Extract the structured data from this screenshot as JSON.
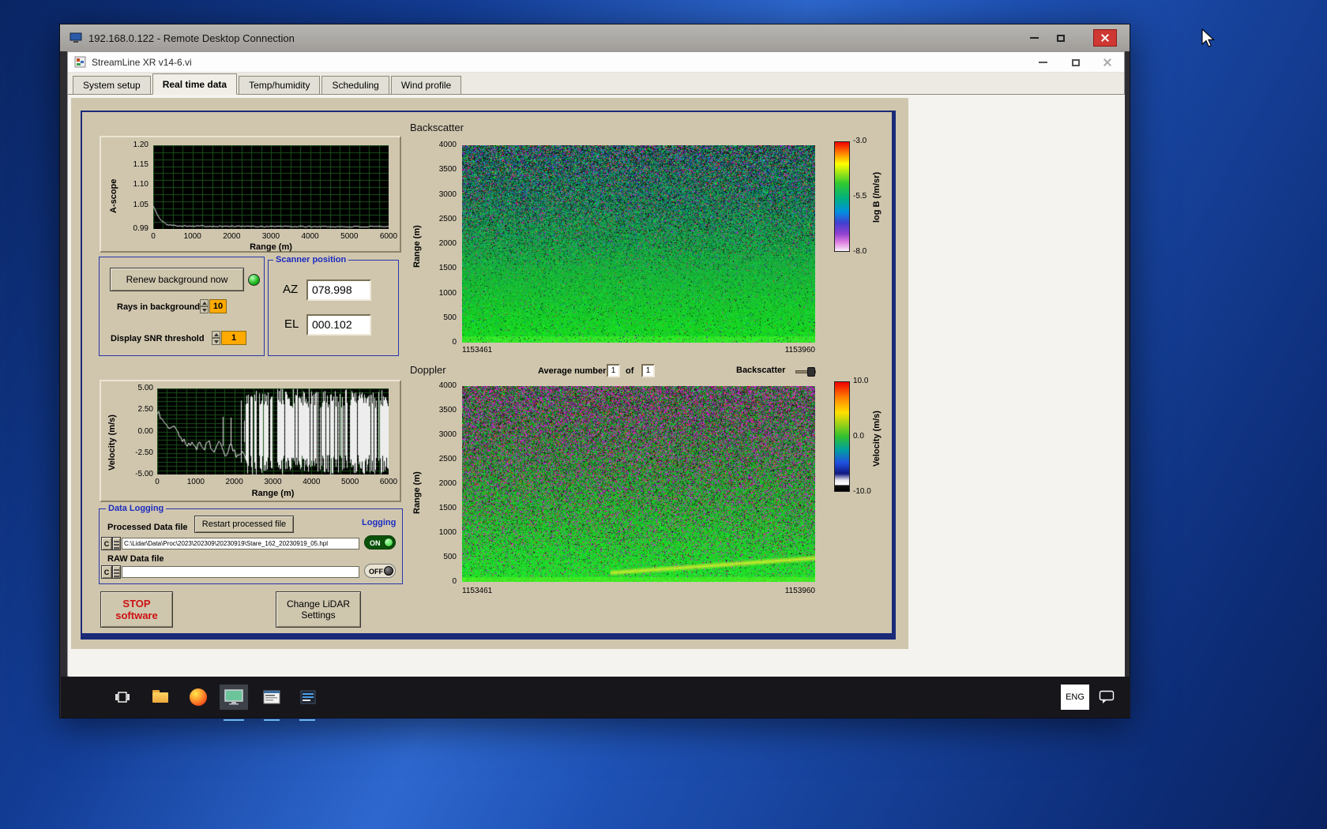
{
  "rdp_window": {
    "title": "192.168.0.122 - Remote Desktop Connection"
  },
  "app_window": {
    "title": "StreamLine XR v14-6.vi",
    "tabs": [
      {
        "label": "System setup"
      },
      {
        "label": "Real time data"
      },
      {
        "label": "Temp/humidity"
      },
      {
        "label": "Scheduling"
      },
      {
        "label": "Wind profile"
      }
    ]
  },
  "panel": {
    "ascope": {
      "ylabel": "A-scope",
      "xlabel": "Range (m)",
      "yticks": [
        "1.20",
        "1.15",
        "1.10",
        "1.05",
        "0.99"
      ],
      "xticks": [
        "0",
        "1000",
        "2000",
        "3000",
        "4000",
        "5000",
        "6000"
      ]
    },
    "background_controls": {
      "renew_button": "Renew background now",
      "rays_label": "Rays in background",
      "rays_value": "10",
      "snr_label": "Display SNR threshold",
      "snr_value": "1"
    },
    "scanner": {
      "title": "Scanner position",
      "az_label": "AZ",
      "az_value": "078.998",
      "el_label": "EL",
      "el_value": "000.102"
    },
    "backscatter": {
      "title": "Backscatter",
      "ylabel": "Range (m)",
      "yticks": [
        "4000",
        "3500",
        "3000",
        "2500",
        "2000",
        "1500",
        "1000",
        "500",
        "0"
      ],
      "x_start": "1153461",
      "x_end": "1153960",
      "colorbar_label": "log B (/m/sr)",
      "colorbar_ticks": [
        "-3.0",
        "-5.5",
        "-8.0"
      ]
    },
    "doppler": {
      "title": "Doppler",
      "average_label": "Average number",
      "average_value": "1",
      "of_label": "of",
      "count_value": "1",
      "toggle_label": "Backscatter",
      "ylabel": "Range (m)",
      "yticks": [
        "4000",
        "3500",
        "3000",
        "2500",
        "2000",
        "1500",
        "1000",
        "500",
        "0"
      ],
      "x_start": "1153461",
      "x_end": "1153960",
      "colorbar_label": "Velocity (m/s)",
      "colorbar_ticks": [
        "10.0",
        "0.0",
        "-10.0"
      ]
    },
    "velocity_scope": {
      "ylabel": "Velocity (m/s)",
      "xlabel": "Range (m)",
      "yticks": [
        "5.00",
        "2.50",
        "0.00",
        "-2.50",
        "-5.00"
      ],
      "xticks": [
        "0",
        "1000",
        "2000",
        "3000",
        "4000",
        "5000",
        "6000"
      ]
    },
    "data_logging": {
      "title": "Data Logging",
      "processed_label": "Processed Data file",
      "restart_button": "Restart processed file",
      "logging_label": "Logging",
      "path_button": "C",
      "processed_path": "C:\\Lidar\\Data\\Proc\\2023\\202309\\20230919\\Stare_162_20230919_05.hpl",
      "on_label": "ON",
      "raw_label": "RAW Data file",
      "raw_path": "",
      "off_label": "OFF"
    },
    "stop_button_line1": "STOP",
    "stop_button_line2": "software",
    "change_button_line1": "Change LiDAR",
    "change_button_line2": "Settings"
  },
  "taskbar": {
    "language": "ENG"
  },
  "colors": {
    "panel_tan": "#d0c6ae",
    "frame_navy": "#1a2a78",
    "field_orange": "#ffaa00",
    "stop_red": "#cc1111",
    "led_green": "#18b414"
  },
  "chart_data": [
    {
      "type": "line",
      "id": "ascope",
      "title": "A-scope background level",
      "xlabel": "Range (m)",
      "ylabel": "A-scope",
      "xlim": [
        0,
        6000
      ],
      "ylim": [
        0.99,
        1.2
      ],
      "x": [
        0,
        100,
        200,
        300,
        400,
        500,
        700,
        1000,
        1500,
        2000,
        2500,
        3000,
        3500,
        4000,
        4500,
        5000,
        5500,
        6000
      ],
      "y": [
        1.048,
        1.026,
        1.011,
        1.004,
        1.0,
        0.999,
        0.998,
        0.9975,
        0.997,
        0.9968,
        0.9966,
        0.9964,
        0.9962,
        0.996,
        0.9959,
        0.9957,
        0.9956,
        0.9955
      ],
      "grid": true
    },
    {
      "type": "line",
      "id": "velocity",
      "title": "Doppler velocity vs range",
      "xlabel": "Range (m)",
      "ylabel": "Velocity (m/s)",
      "xlim": [
        0,
        6000
      ],
      "ylim": [
        -5,
        5
      ],
      "x": [
        0,
        100,
        200,
        300,
        400,
        500,
        600,
        700,
        800,
        900,
        1000,
        1100,
        1200,
        1300,
        1400,
        1500,
        1600,
        1700,
        1800,
        1900,
        2000,
        2100,
        2200,
        2300
      ],
      "y": [
        2.3,
        1.6,
        1.1,
        0.4,
        0.9,
        0.1,
        -0.6,
        -1.2,
        -1.6,
        -1.2,
        -2.0,
        -1.4,
        -2.3,
        -1.0,
        -1.8,
        -2.5,
        -1.2,
        -2.0,
        -2.9,
        -1.6,
        -2.3,
        -3.1,
        -2.2,
        -3.6
      ],
      "noise_region": {
        "from": 2300,
        "to": 6000,
        "amplitude": 5,
        "note": "full-scale random velocity noise beyond aerosol signal"
      },
      "grid": true
    },
    {
      "type": "heatmap",
      "id": "backscatter",
      "title": "Backscatter",
      "ylabel": "Range (m)",
      "ylim": [
        0,
        4000
      ],
      "x_start": 1153461,
      "x_end": 1153960,
      "colorbar": {
        "label": "log B (/m/sr)",
        "min": -8.0,
        "max": -3.0,
        "ticks": [
          -3.0,
          -5.5,
          -8.0
        ]
      },
      "pattern": "speckled multicolor noise above ~2000 m fading into uniform teal-green aerosol backscatter below 1500 m, bright green layer at the ground"
    },
    {
      "type": "heatmap",
      "id": "doppler",
      "title": "Doppler",
      "ylabel": "Range (m)",
      "ylim": [
        0,
        4000
      ],
      "x_start": 1153461,
      "x_end": 1153960,
      "colorbar": {
        "label": "Velocity (m/s)",
        "min": -10.0,
        "max": 10.0,
        "ticks": [
          10.0,
          0.0,
          -10.0
        ]
      },
      "pattern": "magenta/black noise aloft, near-zero (green) velocities below 2000 m, bright yellow-green streak rising toward the right near the ground"
    }
  ]
}
